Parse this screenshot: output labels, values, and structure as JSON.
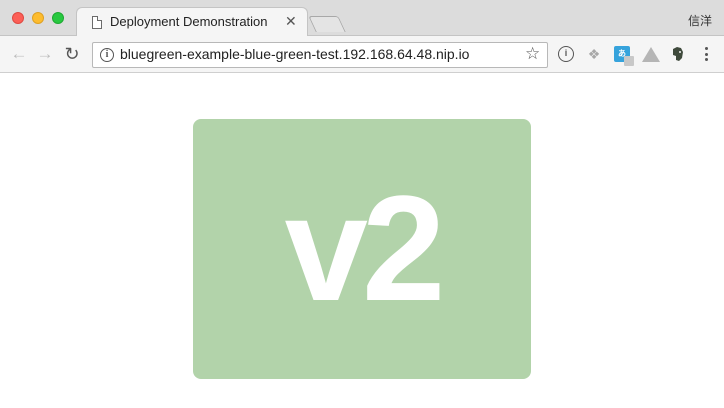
{
  "window": {
    "profile_name": "信洋"
  },
  "tabs": [
    {
      "title": "Deployment Demonstration",
      "close_glyph": "✕",
      "active": true
    }
  ],
  "toolbar": {
    "back_glyph": "←",
    "forward_glyph": "→",
    "reload_glyph": "↻",
    "url": "bluegreen-example-blue-green-test.192.168.64.48.nip.io",
    "info_glyph": "i",
    "bookmark_glyph": "☆",
    "extensions": [
      {
        "icon": "info-circle-icon",
        "glyph": "i"
      },
      {
        "icon": "dropbox-icon",
        "glyph": "❖"
      },
      {
        "icon": "translate-icon",
        "glyph": "あ"
      },
      {
        "icon": "google-drive-icon",
        "glyph": ""
      },
      {
        "icon": "evernote-icon",
        "glyph": "🐘"
      }
    ],
    "menu_icon": "more-vertical-icon"
  },
  "page": {
    "version_label": "v2",
    "card_color": "#b2d3aa",
    "text_color": "#ffffff"
  }
}
